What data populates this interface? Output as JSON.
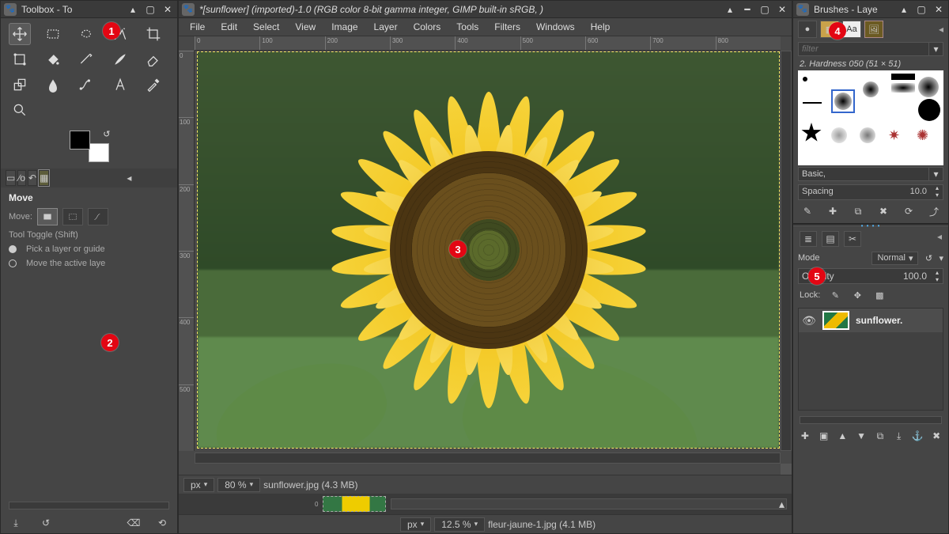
{
  "annotations": [
    "1",
    "2",
    "3",
    "4",
    "5"
  ],
  "toolbox": {
    "title": "Toolbox - To",
    "tools": [
      "move-tool",
      "rect-select-tool",
      "free-select-tool",
      "fuzzy-select-tool",
      "crop-tool",
      "transform-tool",
      "bucket-fill-tool",
      "gradient-tool",
      "paintbrush-tool",
      "eraser-tool",
      "clone-tool",
      "smudge-tool",
      "path-tool",
      "text-tool",
      "color-picker-tool",
      "zoom-tool"
    ],
    "options": {
      "title": "Move",
      "move_label": "Move:",
      "toggle_label": "Tool Toggle  (Shift)",
      "radio_pick": "Pick a layer or guide",
      "radio_active": "Move the active laye"
    }
  },
  "image_window": {
    "title": "*[sunflower] (imported)-1.0 (RGB color 8-bit gamma integer, GIMP built-in sRGB, )",
    "menu": [
      "File",
      "Edit",
      "Select",
      "View",
      "Image",
      "Layer",
      "Colors",
      "Tools",
      "Filters",
      "Windows",
      "Help"
    ],
    "ruler_h": [
      "0",
      "100",
      "200",
      "300",
      "400",
      "500",
      "600",
      "700",
      "800"
    ],
    "ruler_v": [
      "0",
      "100",
      "200",
      "300",
      "400",
      "500"
    ],
    "status": {
      "units": "px",
      "zoom": "80 %",
      "file": "sunflower.jpg (4.3  MB)"
    },
    "status2": {
      "units": "px",
      "zoom": "12.5 %",
      "file": "fleur-jaune-1.jpg (4.1  MB)"
    }
  },
  "brushes": {
    "title": "Brushes - Laye",
    "filter_placeholder": "filter",
    "selected": "2. Hardness 050 (51 × 51)",
    "preset": "Basic,",
    "spacing_label": "Spacing",
    "spacing_value": "10.0"
  },
  "layers": {
    "mode_label": "Mode",
    "mode_value": "Normal",
    "opacity_label": "Opacity",
    "opacity_value": "100.0",
    "lock_label": "Lock:",
    "layer_name": "sunflower."
  }
}
